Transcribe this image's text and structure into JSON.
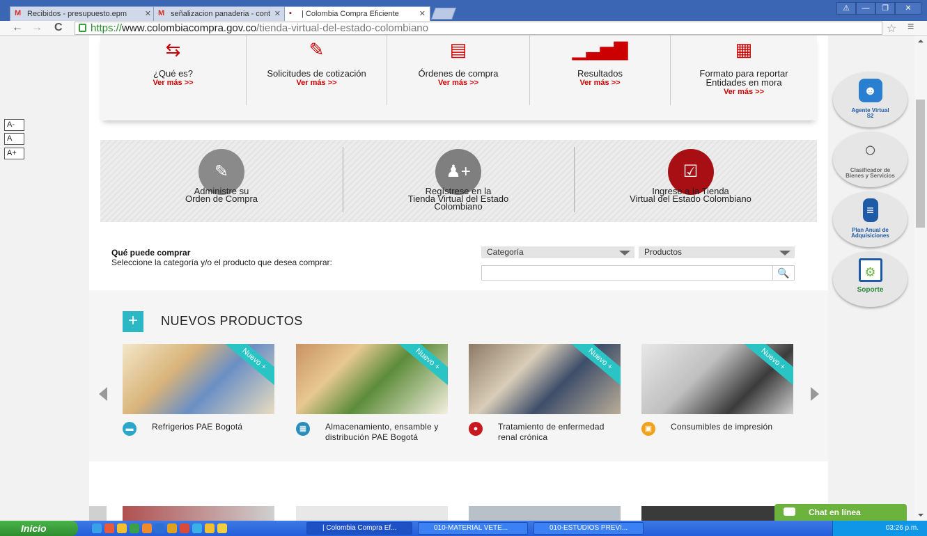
{
  "browser": {
    "tabs": [
      {
        "label": "Recibidos - presupuesto.epm",
        "favicon": "M"
      },
      {
        "label": "señalizacion panaderia - cont",
        "favicon": "M"
      },
      {
        "label": "| Colombia Compra Eficiente",
        "favicon": "▪"
      }
    ],
    "url_scheme": "https://",
    "url_host": "www.colombiacompra.gov.co",
    "url_path": "/tienda-virtual-del-estado-colombiano",
    "window_buttons": [
      "⚠",
      "—",
      "❐",
      "✕"
    ],
    "nav": {
      "back": "←",
      "forward": "→",
      "reload": "C"
    },
    "star": "☆",
    "menu": "≡"
  },
  "font_size": {
    "small": "A-",
    "normal": "A",
    "large": "A+"
  },
  "tiles": [
    {
      "label": "¿Qué es?",
      "more": "Ver más >>",
      "icon": "cart-icon"
    },
    {
      "label": "Solicitudes de cotización",
      "more": "Ver más >>",
      "icon": "edit-form-icon"
    },
    {
      "label": "Órdenes de compra",
      "more": "Ver más >>",
      "icon": "clipboard-icon"
    },
    {
      "label": "Resultados",
      "more": "Ver más >>",
      "icon": "bar-chart-icon"
    },
    {
      "label_line1": "Formato para reportar",
      "label_line2": "Entidades en mora",
      "more": "Ver más >>",
      "icon": "spreadsheet-icon"
    }
  ],
  "actions": [
    {
      "line1": "Administre su",
      "line2": "Orden de Compra",
      "icon": "edit-icon",
      "color": "#8a8a8a"
    },
    {
      "line1": "Regístrese en la",
      "line2": "Tienda Virtual del Estado",
      "line3": "Colombiano",
      "icon": "add-user-icon",
      "color": "#7f7f7f"
    },
    {
      "line1": "Ingrese a la Tienda",
      "line2": "Virtual del Estado Colombiano",
      "icon": "checklist-icon",
      "color": "#a80f14"
    }
  ],
  "buy": {
    "title": "Qué puede comprar",
    "subtitle": "Seleccione la categoría y/o el producto que desea comprar:",
    "category": "Categoría",
    "products": "Productos",
    "search_placeholder": ""
  },
  "new_products": {
    "title": "NUEVOS PRODUCTOS",
    "badge": "Nuevo +",
    "items": [
      {
        "label_line1": "Refrigerios PAE Bogotá",
        "label_line2": "",
        "icon_color": "#2aa7c9",
        "icon": "truck-icon"
      },
      {
        "label_line1": "Almacenamiento, ensamble y",
        "label_line2": "distribución PAE Bogotá",
        "icon_color": "#2a8fb8",
        "icon": "warehouse-icon"
      },
      {
        "label_line1": "Tratamiento de enfermedad",
        "label_line2": "renal crónica",
        "icon_color": "#c8191f",
        "icon": "kidney-icon"
      },
      {
        "label_line1": "Consumibles de impresión",
        "label_line2": "",
        "icon_color": "#f0a21a",
        "icon": "printer-icon"
      }
    ]
  },
  "floating": [
    {
      "label_line1": "Agente Virtual",
      "label_line2": "S2",
      "icon": "robot-icon"
    },
    {
      "label_line1": "Clasificador de",
      "label_line2": "Bienes y Servicios",
      "icon": "magnifier-icon"
    },
    {
      "label_line1": "Plan Anual de",
      "label_line2": "Adquisiciones",
      "icon": "document-icon"
    },
    {
      "label_line1": "Soporte",
      "label_line2": "",
      "icon": "support-icon"
    }
  ],
  "chat": {
    "label": "Chat en línea"
  },
  "taskbar": {
    "start": "Inicio",
    "tasks": [
      "| Colombia Compra Ef...",
      "010-MATERIAL VETE...",
      "010-ESTUDIOS PREVI..."
    ],
    "clock": "03:26 p.m."
  }
}
